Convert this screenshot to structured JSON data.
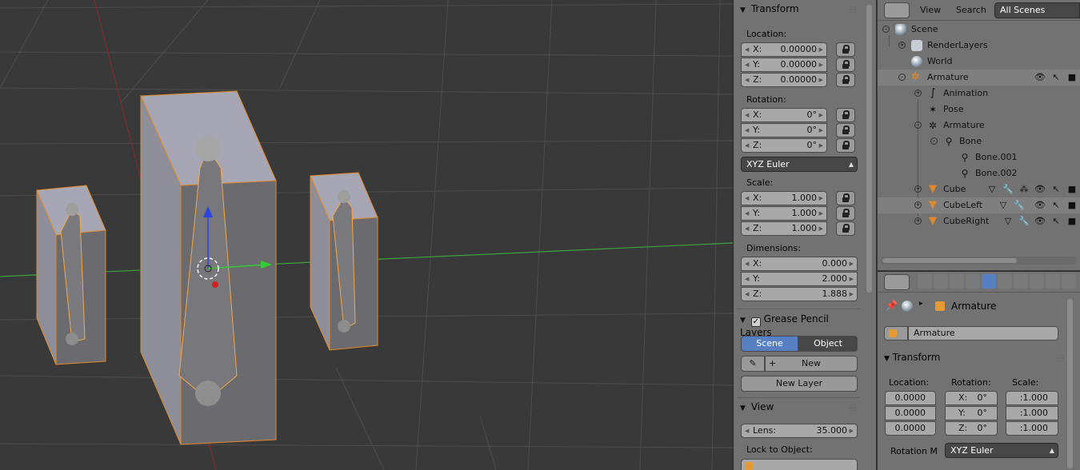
{
  "viewport": {
    "objects": [
      "cube-left",
      "cube-center",
      "cube-right"
    ]
  },
  "npanel": {
    "transform": {
      "title": "Transform",
      "location_label": "Location:",
      "location": [
        {
          "axis": "X:",
          "value": "0.00000"
        },
        {
          "axis": "Y:",
          "value": "0.00000"
        },
        {
          "axis": "Z:",
          "value": "0.00000"
        }
      ],
      "rotation_label": "Rotation:",
      "rotation": [
        {
          "axis": "X:",
          "value": "0°"
        },
        {
          "axis": "Y:",
          "value": "0°"
        },
        {
          "axis": "Z:",
          "value": "0°"
        }
      ],
      "rotation_mode": "XYZ Euler",
      "scale_label": "Scale:",
      "scale": [
        {
          "axis": "X:",
          "value": "1.000"
        },
        {
          "axis": "Y:",
          "value": "1.000"
        },
        {
          "axis": "Z:",
          "value": "1.000"
        }
      ],
      "dimensions_label": "Dimensions:",
      "dimensions": [
        {
          "axis": "X:",
          "value": "0.000"
        },
        {
          "axis": "Y:",
          "value": "2.000"
        },
        {
          "axis": "Z:",
          "value": "1.888"
        }
      ]
    },
    "grease_pencil": {
      "title": "Grease Pencil Layers",
      "checked": true,
      "scene_btn": "Scene",
      "object_btn": "Object",
      "new_btn": "New",
      "new_layer_btn": "New Layer"
    },
    "view": {
      "title": "View",
      "lens_label": "Lens:",
      "lens_value": "35.000",
      "lock_label": "Lock to Object:"
    }
  },
  "outliner": {
    "menu_view": "View",
    "menu_search": "Search",
    "scene_selector": "All Scenes",
    "rows": [
      {
        "label": "Scene"
      },
      {
        "label": "RenderLayers"
      },
      {
        "label": "World"
      },
      {
        "label": "Armature"
      },
      {
        "label": "Animation"
      },
      {
        "label": "Pose"
      },
      {
        "label": "Armature"
      },
      {
        "label": "Bone"
      },
      {
        "label": "Bone.001"
      },
      {
        "label": "Bone.002"
      },
      {
        "label": "Cube"
      },
      {
        "label": "CubeLeft"
      },
      {
        "label": "CubeRight"
      }
    ]
  },
  "properties": {
    "breadcrumb_object": "Armature",
    "name_field": "Armature",
    "transform_title": "Transform",
    "location_label": "Location:",
    "rotation_label": "Rotation:",
    "scale_label": "Scale:",
    "location": [
      "0.0000",
      "0.0000",
      "0.0000"
    ],
    "rotation": [
      {
        "axis": "X:",
        "value": "0°"
      },
      {
        "axis": "Y:",
        "value": "0°"
      },
      {
        "axis": "Z:",
        "value": "0°"
      }
    ],
    "scale": [
      ":1.000",
      ":1.000",
      ":1.000"
    ],
    "rotation_mode_label": "Rotation M",
    "rotation_mode": "XYZ Euler"
  }
}
